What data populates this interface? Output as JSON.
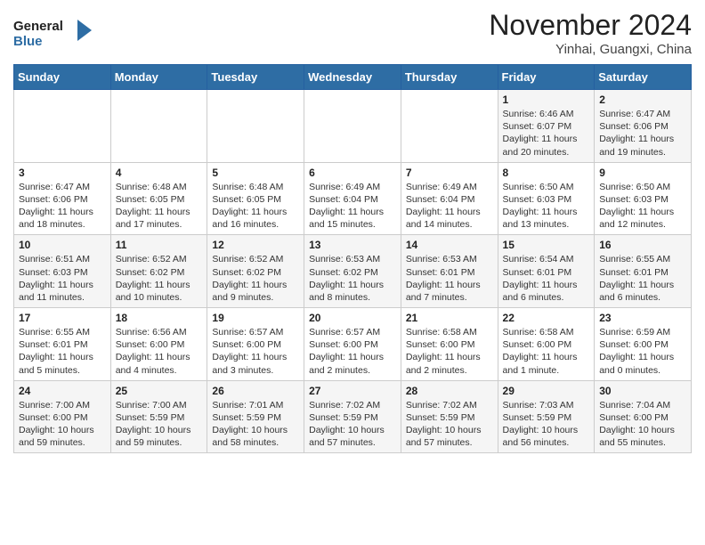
{
  "header": {
    "logo_general": "General",
    "logo_blue": "Blue",
    "month_title": "November 2024",
    "location": "Yinhai, Guangxi, China"
  },
  "weekdays": [
    "Sunday",
    "Monday",
    "Tuesday",
    "Wednesday",
    "Thursday",
    "Friday",
    "Saturday"
  ],
  "weeks": [
    [
      {
        "day": "",
        "info": ""
      },
      {
        "day": "",
        "info": ""
      },
      {
        "day": "",
        "info": ""
      },
      {
        "day": "",
        "info": ""
      },
      {
        "day": "",
        "info": ""
      },
      {
        "day": "1",
        "info": "Sunrise: 6:46 AM\nSunset: 6:07 PM\nDaylight: 11 hours\nand 20 minutes."
      },
      {
        "day": "2",
        "info": "Sunrise: 6:47 AM\nSunset: 6:06 PM\nDaylight: 11 hours\nand 19 minutes."
      }
    ],
    [
      {
        "day": "3",
        "info": "Sunrise: 6:47 AM\nSunset: 6:06 PM\nDaylight: 11 hours\nand 18 minutes."
      },
      {
        "day": "4",
        "info": "Sunrise: 6:48 AM\nSunset: 6:05 PM\nDaylight: 11 hours\nand 17 minutes."
      },
      {
        "day": "5",
        "info": "Sunrise: 6:48 AM\nSunset: 6:05 PM\nDaylight: 11 hours\nand 16 minutes."
      },
      {
        "day": "6",
        "info": "Sunrise: 6:49 AM\nSunset: 6:04 PM\nDaylight: 11 hours\nand 15 minutes."
      },
      {
        "day": "7",
        "info": "Sunrise: 6:49 AM\nSunset: 6:04 PM\nDaylight: 11 hours\nand 14 minutes."
      },
      {
        "day": "8",
        "info": "Sunrise: 6:50 AM\nSunset: 6:03 PM\nDaylight: 11 hours\nand 13 minutes."
      },
      {
        "day": "9",
        "info": "Sunrise: 6:50 AM\nSunset: 6:03 PM\nDaylight: 11 hours\nand 12 minutes."
      }
    ],
    [
      {
        "day": "10",
        "info": "Sunrise: 6:51 AM\nSunset: 6:03 PM\nDaylight: 11 hours\nand 11 minutes."
      },
      {
        "day": "11",
        "info": "Sunrise: 6:52 AM\nSunset: 6:02 PM\nDaylight: 11 hours\nand 10 minutes."
      },
      {
        "day": "12",
        "info": "Sunrise: 6:52 AM\nSunset: 6:02 PM\nDaylight: 11 hours\nand 9 minutes."
      },
      {
        "day": "13",
        "info": "Sunrise: 6:53 AM\nSunset: 6:02 PM\nDaylight: 11 hours\nand 8 minutes."
      },
      {
        "day": "14",
        "info": "Sunrise: 6:53 AM\nSunset: 6:01 PM\nDaylight: 11 hours\nand 7 minutes."
      },
      {
        "day": "15",
        "info": "Sunrise: 6:54 AM\nSunset: 6:01 PM\nDaylight: 11 hours\nand 6 minutes."
      },
      {
        "day": "16",
        "info": "Sunrise: 6:55 AM\nSunset: 6:01 PM\nDaylight: 11 hours\nand 6 minutes."
      }
    ],
    [
      {
        "day": "17",
        "info": "Sunrise: 6:55 AM\nSunset: 6:01 PM\nDaylight: 11 hours\nand 5 minutes."
      },
      {
        "day": "18",
        "info": "Sunrise: 6:56 AM\nSunset: 6:00 PM\nDaylight: 11 hours\nand 4 minutes."
      },
      {
        "day": "19",
        "info": "Sunrise: 6:57 AM\nSunset: 6:00 PM\nDaylight: 11 hours\nand 3 minutes."
      },
      {
        "day": "20",
        "info": "Sunrise: 6:57 AM\nSunset: 6:00 PM\nDaylight: 11 hours\nand 2 minutes."
      },
      {
        "day": "21",
        "info": "Sunrise: 6:58 AM\nSunset: 6:00 PM\nDaylight: 11 hours\nand 2 minutes."
      },
      {
        "day": "22",
        "info": "Sunrise: 6:58 AM\nSunset: 6:00 PM\nDaylight: 11 hours\nand 1 minute."
      },
      {
        "day": "23",
        "info": "Sunrise: 6:59 AM\nSunset: 6:00 PM\nDaylight: 11 hours\nand 0 minutes."
      }
    ],
    [
      {
        "day": "24",
        "info": "Sunrise: 7:00 AM\nSunset: 6:00 PM\nDaylight: 10 hours\nand 59 minutes."
      },
      {
        "day": "25",
        "info": "Sunrise: 7:00 AM\nSunset: 5:59 PM\nDaylight: 10 hours\nand 59 minutes."
      },
      {
        "day": "26",
        "info": "Sunrise: 7:01 AM\nSunset: 5:59 PM\nDaylight: 10 hours\nand 58 minutes."
      },
      {
        "day": "27",
        "info": "Sunrise: 7:02 AM\nSunset: 5:59 PM\nDaylight: 10 hours\nand 57 minutes."
      },
      {
        "day": "28",
        "info": "Sunrise: 7:02 AM\nSunset: 5:59 PM\nDaylight: 10 hours\nand 57 minutes."
      },
      {
        "day": "29",
        "info": "Sunrise: 7:03 AM\nSunset: 5:59 PM\nDaylight: 10 hours\nand 56 minutes."
      },
      {
        "day": "30",
        "info": "Sunrise: 7:04 AM\nSunset: 6:00 PM\nDaylight: 10 hours\nand 55 minutes."
      }
    ]
  ]
}
